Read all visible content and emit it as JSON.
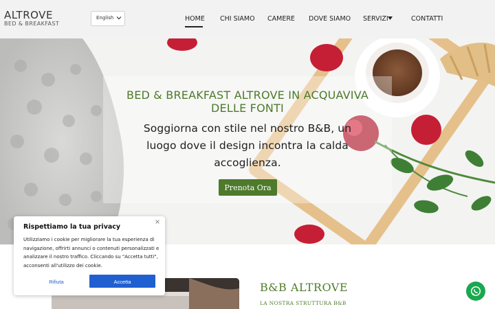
{
  "brand": {
    "name": "ALTROVE",
    "tagline": "BED & BREAKFAST"
  },
  "language": {
    "selected": "English"
  },
  "nav": {
    "items": [
      {
        "label": "HOME",
        "active": true
      },
      {
        "label": "CHI SIAMO"
      },
      {
        "label": "CAMERE"
      },
      {
        "label": "DOVE SIAMO"
      },
      {
        "label": "SERVIZI",
        "has_dropdown": true
      },
      {
        "label": "CONTATTI"
      }
    ]
  },
  "hero": {
    "title": "BED & BREAKFAST ALTROVE IN ACQUAVIVA DELLE FONTI",
    "text": "Soggiorna con stile nel nostro B&B, un luogo dove il design incontra la calda accoglienza.",
    "cta_label": "Prenota Ora"
  },
  "section": {
    "title": "B&B ALTROVE",
    "subtitle": "LA NOSTRA STRUTTURA B&B"
  },
  "cookie": {
    "title": "Rispettiamo la tua privacy",
    "text": "Utilizziamo i cookie per migliorare la tua esperienza di navigazione, offrirti annunci o contenuti personalizzati e analizzare il nostro traffico. Cliccando su \"Accetta tutti\", acconsenti all'utilizzo dei cookie.",
    "reject_label": "Rifiuta",
    "accept_label": "Accetta",
    "close_symbol": "×"
  },
  "colors": {
    "accent_green": "#4e7a2c",
    "cookie_blue": "#1f5fd0",
    "whatsapp_green": "#1aa84f"
  },
  "icons": {
    "language_chevron": "chevron-down-icon",
    "servizi_caret": "caret-down-icon",
    "whatsapp": "whatsapp-icon",
    "cookie_close": "close-icon"
  }
}
